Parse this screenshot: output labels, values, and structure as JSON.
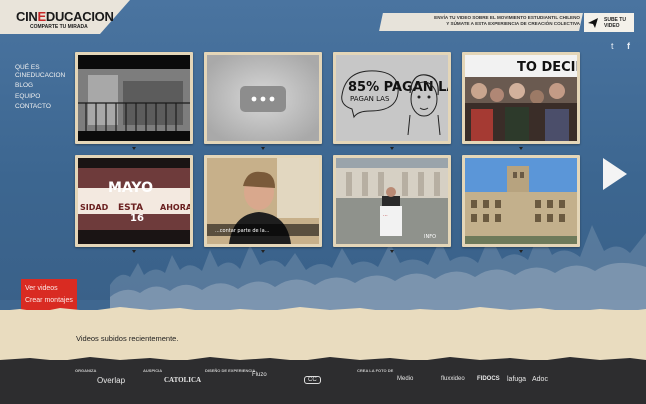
{
  "brand": {
    "title_part1": "CIN",
    "title_mid": "E",
    "title_part2": "DUCACION",
    "subtitle": "COMPARTE TU MIRADA"
  },
  "nav": {
    "items": [
      "QUÉ ES CINEDUCACION",
      "BLOG",
      "EQUIPO",
      "CONTACTO"
    ]
  },
  "banner": {
    "line1": "ENVÍA TU VIDEO SOBRE EL MOVIMIENTO ESTUDIANTIL CHILENO",
    "line2": "Y SÚMATE A ESTA EXPERIENCIA DE CREACIÓN COLECTIVA"
  },
  "upload": {
    "label_line1": "SUBE TU",
    "label_line2": "VIDEO"
  },
  "social": {
    "twitter": "t",
    "facebook": "f"
  },
  "thumbnails": {
    "t3_text": "85% PAGAN LAS",
    "t4_text": "TO DECID",
    "t5_text_top": "MAYO",
    "t5_text_num": "16",
    "t5_side_left": "SIDAD",
    "t5_side_right": "AHORA",
    "t5_side_mid": "ESTA",
    "t6_caption": "...contar parte de la...",
    "t7_sign": "...",
    "t7_tag": "INFO"
  },
  "side_menu": {
    "item1": "Ver videos",
    "item2": "Crear montajes"
  },
  "recent": {
    "label": "Videos subidos recientemente."
  },
  "footer": {
    "labels": [
      "ORGANIZA",
      "AUSPICIA",
      "DISEÑO DE EXPERIENCIA",
      "CREA LA FOTO DE"
    ],
    "logos": [
      "Overlap",
      "CATOLICA",
      "Fluzo",
      "CC",
      "Medio",
      "fluxxideo",
      "FIDOCS",
      "lafuga",
      "Adoc"
    ]
  },
  "colors": {
    "accent_red": "#d92b22",
    "bg_blue": "#3f6790",
    "paper": "#e9dcbf"
  }
}
